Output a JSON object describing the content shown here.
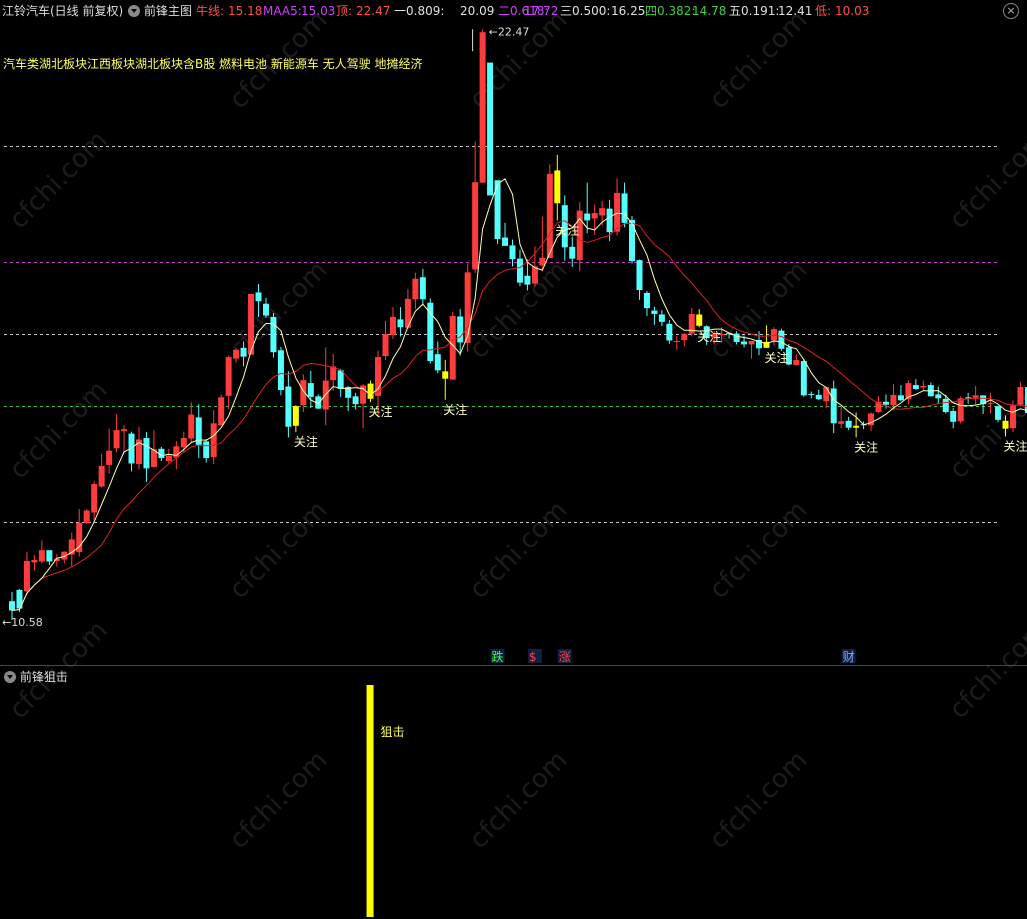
{
  "header": {
    "stock": "江铃汽车(日线 前复权)",
    "indicator": "前锋主图",
    "niu_label": "牛线:",
    "niu_value": "15.18",
    "maa5_label": "MAA5:",
    "maa5_value": "15.03",
    "top_label": "顶:",
    "top_value": "22.47",
    "f1_label": "一0.809:",
    "f1_value": "20.09",
    "f2_label": "二0.618:",
    "f2_value": "17.72",
    "f3_label": "三0.500:",
    "f3_value": "16.25",
    "f4_label": "四0.382:",
    "f4_value": "14.78",
    "f5_label": "五0.191:",
    "f5_value": "12.41",
    "low_label": "低:",
    "low_value": "10.03",
    "close_glyph": "×"
  },
  "colors": {
    "up": "#ff3b3b",
    "down": "#54ffff",
    "signal": "#ffff00",
    "ma_fast": "#ffffb0",
    "ma_slow": "#e02020",
    "fib_purple": "#c040c0",
    "fib_green": "#40c040",
    "fib_white": "#c8c8c8"
  },
  "sectors": "汽车类湖北板块江西板块湖北板块含B股 燃料电池 新能源车 无人驾驶 地摊经济",
  "lower_panel": {
    "title": "前锋狙击",
    "signal_label": "狙击"
  },
  "watermark": "cfchi.com",
  "chart_data": {
    "type": "candlestick",
    "title": "前锋主图",
    "ylim": [
      9.6,
      22.7
    ],
    "fib_levels": [
      {
        "name": "一0.809",
        "value": 20.09,
        "color": "white"
      },
      {
        "name": "二0.618",
        "value": 17.72,
        "color": "purple"
      },
      {
        "name": "三0.500",
        "value": 16.25,
        "color": "white"
      },
      {
        "name": "四0.382",
        "value": 14.78,
        "color": "green"
      },
      {
        "name": "五0.191",
        "value": 12.41,
        "color": "white"
      }
    ],
    "high_label": "22.47",
    "low_label": "10.58",
    "annotations": [
      {
        "bar": 38,
        "text": "关注"
      },
      {
        "bar": 48,
        "text": "关注"
      },
      {
        "bar": 58,
        "text": "关注"
      },
      {
        "bar": 73,
        "text": "关注"
      },
      {
        "bar": 92,
        "text": "关注"
      },
      {
        "bar": 101,
        "text": "关注"
      },
      {
        "bar": 113,
        "text": "关注"
      },
      {
        "bar": 133,
        "text": "关注"
      }
    ],
    "events": [
      {
        "bar": 65,
        "text": "跌",
        "color": "#40ff40"
      },
      {
        "bar": 70,
        "text": "$",
        "color": "#ff4040"
      },
      {
        "bar": 74,
        "text": "涨",
        "color": "#ff4040"
      },
      {
        "bar": 112,
        "text": "财",
        "color": "#7ab0ff"
      }
    ],
    "candles": [
      [
        10.8,
        10.61,
        10.99,
        10.42
      ],
      [
        11.03,
        10.65,
        11.05,
        10.58
      ],
      [
        11.0,
        11.62,
        11.81,
        10.92
      ],
      [
        11.59,
        11.64,
        11.74,
        11.42
      ],
      [
        11.61,
        11.84,
        12.04,
        11.57
      ],
      [
        11.84,
        11.61,
        11.84,
        11.54
      ],
      [
        11.62,
        11.67,
        11.76,
        11.51
      ],
      [
        11.65,
        11.81,
        11.82,
        11.57
      ],
      [
        11.75,
        12.06,
        12.2,
        11.5
      ],
      [
        11.8,
        12.4,
        12.68,
        11.71
      ],
      [
        12.39,
        12.65,
        12.68,
        12.38
      ],
      [
        12.61,
        13.19,
        13.25,
        12.42
      ],
      [
        13.14,
        13.56,
        13.81,
        13.12
      ],
      [
        13.58,
        13.87,
        14.32,
        13.4
      ],
      [
        13.92,
        14.29,
        14.62,
        13.84
      ],
      [
        14.27,
        14.31,
        14.39,
        13.81
      ],
      [
        14.22,
        13.61,
        14.26,
        13.45
      ],
      [
        13.6,
        14.1,
        14.36,
        13.49
      ],
      [
        14.13,
        13.51,
        14.25,
        13.23
      ],
      [
        13.54,
        13.9,
        14.29,
        13.52
      ],
      [
        13.91,
        13.72,
        13.95,
        13.66
      ],
      [
        13.66,
        13.77,
        13.91,
        13.6
      ],
      [
        13.73,
        13.96,
        14.07,
        13.49
      ],
      [
        13.94,
        14.13,
        14.26,
        13.84
      ],
      [
        14.12,
        14.61,
        14.86,
        14.03
      ],
      [
        14.55,
        13.99,
        14.82,
        13.72
      ],
      [
        14.06,
        13.72,
        14.11,
        13.63
      ],
      [
        13.74,
        14.43,
        14.7,
        13.6
      ],
      [
        14.39,
        14.96,
        15.02,
        14.38
      ],
      [
        14.99,
        15.78,
        15.81,
        14.72
      ],
      [
        15.75,
        15.93,
        15.96,
        15.67
      ],
      [
        15.97,
        15.79,
        16.1,
        15.59
      ],
      [
        15.83,
        17.07,
        17.02,
        16.62
      ],
      [
        17.1,
        16.92,
        17.27,
        16.6
      ],
      [
        16.87,
        16.63,
        16.99,
        16.58
      ],
      [
        16.6,
        15.88,
        16.68,
        15.77
      ],
      [
        15.92,
        15.11,
        15.99,
        15.0
      ],
      [
        15.18,
        14.36,
        15.49,
        14.14
      ],
      [
        14.38,
        14.78,
        14.8,
        14.25
      ],
      [
        14.8,
        15.31,
        15.43,
        14.66
      ],
      [
        15.25,
        14.97,
        15.5,
        14.74
      ],
      [
        14.98,
        14.73,
        15.02,
        14.72
      ],
      [
        14.71,
        15.3,
        15.98,
        14.39
      ],
      [
        15.31,
        15.59,
        15.85,
        15.09
      ],
      [
        15.51,
        15.13,
        15.54,
        14.97
      ],
      [
        15.17,
        14.95,
        15.19,
        14.68
      ],
      [
        14.98,
        14.82,
        15.05,
        14.71
      ],
      [
        14.83,
        15.2,
        15.23,
        14.33
      ],
      [
        15.24,
        14.93,
        15.3,
        14.86
      ],
      [
        14.99,
        15.78,
        15.91,
        14.55
      ],
      [
        15.8,
        16.25,
        16.52,
        15.72
      ],
      [
        16.23,
        16.6,
        16.8,
        16.15
      ],
      [
        16.55,
        16.39,
        16.8,
        16.2
      ],
      [
        16.38,
        16.97,
        17.17,
        16.35
      ],
      [
        16.96,
        17.38,
        17.5,
        16.76
      ],
      [
        17.41,
        16.96,
        17.58,
        16.84
      ],
      [
        16.89,
        15.7,
        16.98,
        15.65
      ],
      [
        15.84,
        15.51,
        16.1,
        15.45
      ],
      [
        15.49,
        15.34,
        15.72,
        14.91
      ],
      [
        15.32,
        16.62,
        16.7,
        15.43
      ],
      [
        16.61,
        16.08,
        16.76,
        15.81
      ],
      [
        16.07,
        17.51,
        17.69,
        15.89
      ],
      [
        17.57,
        19.35,
        20.18,
        17.5
      ],
      [
        19.34,
        22.41,
        22.47,
        20.79
      ],
      [
        21.79,
        19.08,
        20.24,
        19.33
      ],
      [
        19.39,
        18.19,
        19.38,
        18.09
      ],
      [
        18.22,
        18.05,
        18.52,
        18.1
      ],
      [
        18.06,
        17.78,
        18.18,
        17.63
      ],
      [
        17.79,
        17.3,
        17.97,
        17.23
      ],
      [
        17.44,
        17.26,
        17.77,
        17.14
      ],
      [
        17.28,
        17.63,
        18.04,
        17.22
      ],
      [
        17.65,
        17.81,
        18.65,
        17.53
      ],
      [
        17.8,
        19.52,
        19.71,
        17.86
      ],
      [
        19.59,
        18.92,
        19.91,
        18.57
      ],
      [
        18.88,
        18.02,
        19.08,
        17.75
      ],
      [
        18.03,
        17.79,
        18.24,
        17.62
      ],
      [
        17.76,
        18.77,
        18.94,
        17.54
      ],
      [
        18.71,
        18.57,
        19.34,
        18.31
      ],
      [
        18.61,
        18.72,
        18.89,
        18.28
      ],
      [
        18.67,
        18.82,
        18.97,
        18.47
      ],
      [
        18.81,
        18.33,
        18.99,
        18.15
      ],
      [
        18.34,
        19.13,
        19.43,
        18.26
      ],
      [
        19.12,
        18.52,
        19.34,
        18.43
      ],
      [
        18.58,
        17.74,
        18.66,
        17.69
      ],
      [
        17.76,
        17.15,
        17.77,
        16.95
      ],
      [
        17.09,
        16.78,
        17.13,
        16.62
      ],
      [
        16.73,
        16.66,
        16.81,
        16.44
      ],
      [
        16.65,
        16.5,
        16.74,
        16.41
      ],
      [
        16.46,
        16.12,
        16.54,
        16.05
      ],
      [
        16.1,
        16.11,
        16.21,
        15.93
      ],
      [
        16.13,
        16.25,
        16.27,
        16.0
      ],
      [
        16.26,
        16.66,
        16.78,
        16.2
      ],
      [
        16.65,
        16.42,
        16.76,
        16.39
      ],
      [
        16.41,
        16.17,
        16.43,
        16.03
      ],
      [
        16.18,
        16.26,
        16.31,
        16.04
      ],
      [
        16.25,
        16.25,
        16.39,
        16.07
      ],
      [
        16.27,
        16.26,
        16.28,
        16.16
      ],
      [
        16.26,
        16.09,
        16.31,
        16.04
      ],
      [
        16.1,
        16.04,
        16.22,
        15.98
      ],
      [
        16.04,
        16.11,
        16.09,
        15.75
      ],
      [
        16.13,
        15.96,
        16.31,
        15.82
      ],
      [
        15.97,
        16.09,
        16.43,
        15.97
      ],
      [
        16.12,
        16.35,
        16.39,
        16.02
      ],
      [
        16.32,
        15.95,
        16.36,
        15.91
      ],
      [
        15.98,
        15.63,
        16.05,
        15.61
      ],
      [
        15.62,
        15.72,
        15.84,
        15.61
      ],
      [
        15.7,
        15.0,
        15.74,
        14.97
      ],
      [
        15.03,
        15.01,
        15.08,
        14.94
      ],
      [
        15.01,
        14.92,
        15.12,
        14.9
      ],
      [
        14.88,
        15.17,
        15.17,
        14.74
      ],
      [
        15.14,
        14.43,
        15.3,
        14.23
      ],
      [
        14.42,
        14.47,
        14.77,
        14.33
      ],
      [
        14.48,
        14.34,
        14.56,
        14.29
      ],
      [
        14.34,
        14.38,
        14.65,
        14.14
      ],
      [
        14.41,
        14.39,
        14.47,
        14.31
      ],
      [
        14.39,
        14.63,
        14.65,
        14.27
      ],
      [
        14.66,
        14.87,
        14.98,
        14.64
      ],
      [
        14.87,
        14.81,
        15.02,
        14.73
      ],
      [
        14.8,
        15.01,
        15.23,
        14.7
      ],
      [
        15.0,
        14.9,
        15.21,
        14.88
      ],
      [
        14.92,
        15.25,
        15.31,
        14.81
      ],
      [
        15.21,
        15.13,
        15.33,
        15.11
      ],
      [
        15.16,
        15.19,
        15.3,
        15.09
      ],
      [
        15.21,
        14.98,
        15.26,
        14.98
      ],
      [
        15.02,
        14.94,
        15.18,
        14.82
      ],
      [
        14.93,
        14.66,
        15.01,
        14.63
      ],
      [
        14.68,
        14.46,
        14.74,
        14.33
      ],
      [
        14.47,
        14.94,
        14.98,
        14.43
      ],
      [
        14.96,
        14.95,
        15.05,
        14.83
      ],
      [
        14.95,
        15.0,
        15.19,
        14.81
      ],
      [
        15.0,
        14.82,
        15.0,
        14.62
      ],
      [
        14.83,
        14.84,
        15.05,
        14.63
      ],
      [
        14.78,
        14.5,
        14.79,
        14.45
      ],
      [
        14.48,
        14.32,
        14.59,
        14.16
      ],
      [
        14.33,
        14.8,
        14.9,
        14.25
      ],
      [
        14.81,
        15.17,
        15.27,
        14.78
      ],
      [
        15.17,
        14.64,
        15.25,
        14.59
      ],
      [
        14.68,
        14.14,
        14.75,
        13.96
      ]
    ],
    "signal_bars": [
      38,
      48,
      58,
      73,
      92,
      101,
      113,
      133
    ],
    "ma_fast": [],
    "ma_slow": [],
    "lower_signal": {
      "bar": 48,
      "value": 1
    }
  }
}
